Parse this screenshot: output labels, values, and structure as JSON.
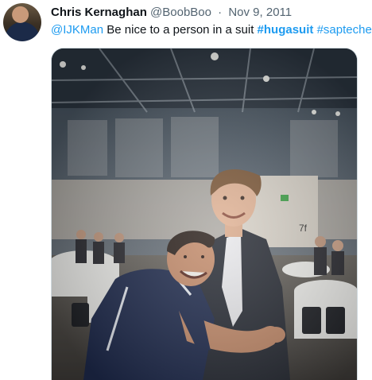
{
  "tweet": {
    "author_name": "Chris Kernaghan",
    "author_handle": "@BoobBoo",
    "separator": "·",
    "date": "Nov 9, 2011",
    "mention": "@IJKMan",
    "text": " Be nice to a person in a suit ",
    "hashtag_1": "#hugasuit",
    "hashtag_2": "#saptechec"
  },
  "media": {
    "photo_sign": "7f",
    "description_icon": "photo"
  },
  "colors": {
    "link": "#1d9bf0",
    "secondary_text": "#536471",
    "border": "#cfd9de"
  }
}
